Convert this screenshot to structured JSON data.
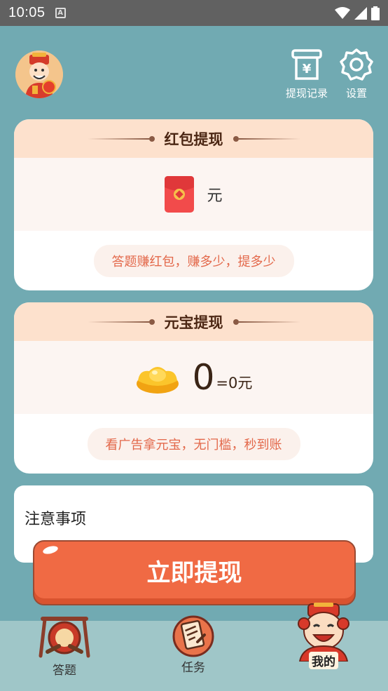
{
  "status_bar": {
    "time": "10:05",
    "badge": "A"
  },
  "header": {
    "withdraw_records_label": "提现记录",
    "settings_label": "设置"
  },
  "redpacket_card": {
    "title": "红包提现",
    "amount_unit": "元",
    "slogan": "答题赚红包，赚多少，提多少"
  },
  "ingot_card": {
    "title": "元宝提现",
    "amount": "0",
    "equivalent": "=0元",
    "slogan": "看广告拿元宝，无门槛，秒到账"
  },
  "notice": {
    "title": "注意事项"
  },
  "withdraw_button": {
    "label": "立即提现"
  },
  "bottom_nav": [
    {
      "label": "答题",
      "icon": "drum-icon"
    },
    {
      "label": "任务",
      "icon": "task-scroll-icon"
    },
    {
      "label": "我的",
      "icon": "god-of-wealth-icon",
      "active": true
    }
  ],
  "colors": {
    "background": "#71aab2",
    "card_head": "#fde1cd",
    "accent": "#f06a44",
    "slogan_text": "#e3684a"
  }
}
